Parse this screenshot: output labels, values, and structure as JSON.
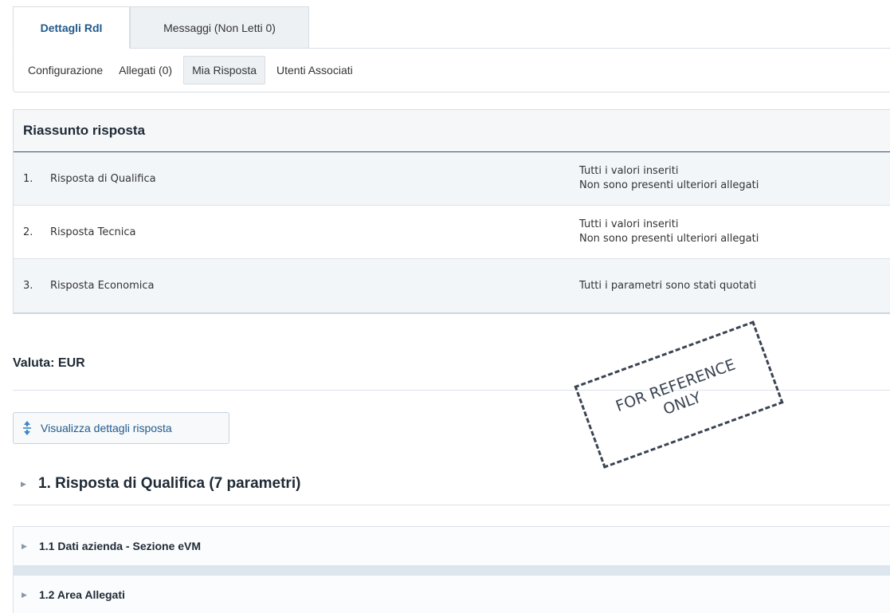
{
  "tabs": [
    {
      "label": "Dettagli RdI",
      "active": true
    },
    {
      "label": "Messaggi (Non Letti 0)",
      "active": false
    }
  ],
  "subtabs": [
    {
      "label": "Configurazione",
      "selected": false
    },
    {
      "label": "Allegati (0)",
      "selected": false
    },
    {
      "label": "Mia Risposta",
      "selected": true
    },
    {
      "label": "Utenti Associati",
      "selected": false
    }
  ],
  "summary": {
    "title": "Riassunto risposta",
    "rows": [
      {
        "num": "1.",
        "name": "Risposta di Qualifica",
        "status_line1": "Tutti i valori inseriti",
        "status_line2": "Non sono presenti ulteriori allegati"
      },
      {
        "num": "2.",
        "name": "Risposta Tecnica",
        "status_line1": "Tutti i valori inseriti",
        "status_line2": "Non sono presenti ulteriori allegati"
      },
      {
        "num": "3.",
        "name": "Risposta Economica",
        "status_line1": "Tutti i parametri sono stati quotati",
        "status_line2": ""
      }
    ]
  },
  "currency": {
    "label": "Valuta: EUR"
  },
  "details_button": {
    "label": "Visualizza dettagli risposta",
    "icon": "expand-vertical-icon"
  },
  "section": {
    "title": "1. Risposta di Qualifica (7 parametri)"
  },
  "subsections": [
    {
      "title": "1.1  Dati azienda - Sezione eVM"
    },
    {
      "title": "1.2 Area Allegati"
    }
  ],
  "watermark": {
    "text_line1": "FOR REFERENCE",
    "text_line2": "ONLY"
  },
  "colors": {
    "accent": "#215a8c",
    "header_border": "#33506b",
    "row_alt": "#f3f6f9",
    "band": "#dde6ee"
  }
}
